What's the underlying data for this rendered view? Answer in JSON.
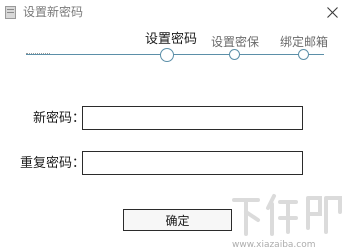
{
  "window": {
    "title": "设置新密码",
    "close_symbol": "✕"
  },
  "steps": [
    {
      "label": "设置密码",
      "state": "active"
    },
    {
      "label": "设置密保",
      "state": "inactive"
    },
    {
      "label": "绑定邮箱",
      "state": "inactive"
    }
  ],
  "form": {
    "new_password_label": "新密码：",
    "new_password_value": "",
    "repeat_password_label": "重复密码：",
    "repeat_password_value": ""
  },
  "buttons": {
    "confirm_label": "确定"
  },
  "watermark": {
    "logo_text": "下载吧",
    "url_text": "www.xiazaiba.com"
  },
  "colors": {
    "accent": "#5b8fa8",
    "border": "#2b2b2b"
  }
}
